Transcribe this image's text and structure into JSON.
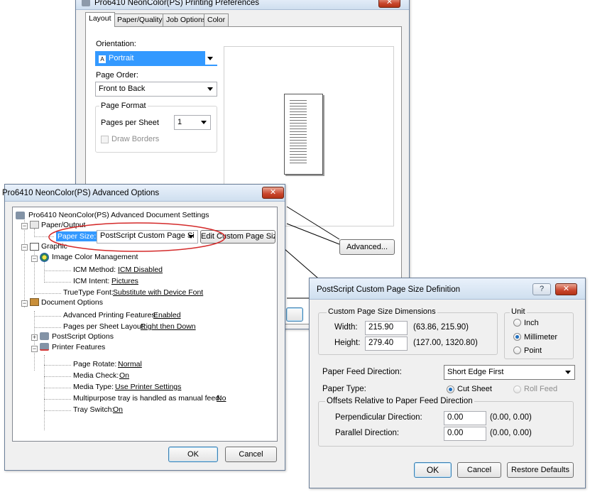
{
  "prefs": {
    "title": "Pro6410 NeonColor(PS) Printing Preferences",
    "tabs": [
      "Layout",
      "Paper/Quality",
      "Job Options",
      "Color"
    ],
    "orientation_label": "Orientation:",
    "orientation_value": "Portrait",
    "page_order_label": "Page Order:",
    "page_order_value": "Front to Back",
    "page_format_title": "Page Format",
    "pages_per_sheet_label": "Pages per Sheet",
    "pages_per_sheet_value": "1",
    "draw_borders_label": "Draw Borders",
    "advanced_button": "Advanced..."
  },
  "advanced": {
    "title": "Pro6410 NeonColor(PS) Advanced Options",
    "tree": {
      "root": "Pro6410 NeonColor(PS) Advanced Document Settings",
      "paper_output": "Paper/Output",
      "paper_size_label": "Paper Size:",
      "paper_size_value": "PostScript Custom Page Si",
      "edit_custom_button": "Edit Custom Page Size...",
      "graphic": "Graphic",
      "icm": "Image Color Management",
      "icm_method_label": "ICM Method:",
      "icm_method_value": "ICM Disabled",
      "icm_intent_label": "ICM Intent:",
      "icm_intent_value": "Pictures",
      "truetype_label": "TrueType Font:",
      "truetype_value": "Substitute with Device Font",
      "doc_options": "Document Options",
      "adv_printing_label": "Advanced Printing Features:",
      "adv_printing_value": "Enabled",
      "pages_layout_label": "Pages per Sheet Layout:",
      "pages_layout_value": "Right then Down",
      "ps_options": "PostScript Options",
      "printer_features": "Printer Features",
      "page_rotate_label": "Page Rotate:",
      "page_rotate_value": "Normal",
      "media_check_label": "Media Check:",
      "media_check_value": "On",
      "media_type_label": "Media Type:",
      "media_type_value": "Use Printer Settings",
      "multipurpose_label": "Multipurpose tray is handled as manual feed:",
      "multipurpose_value": "No",
      "tray_switch_label": "Tray Switch:",
      "tray_switch_value": "On"
    },
    "ok": "OK",
    "cancel": "Cancel"
  },
  "custom": {
    "title": "PostScript Custom Page Size Definition",
    "help": "?",
    "dims_title": "Custom Page Size Dimensions",
    "width_label": "Width:",
    "width_value": "215.90",
    "width_range": "(63.86, 215.90)",
    "height_label": "Height:",
    "height_value": "279.40",
    "height_range": "(127.00, 1320.80)",
    "unit_title": "Unit",
    "unit_inch": "Inch",
    "unit_mm": "Millimeter",
    "unit_point": "Point",
    "feed_dir_label": "Paper Feed Direction:",
    "feed_dir_value": "Short Edge First",
    "paper_type_label": "Paper Type:",
    "cut_sheet": "Cut Sheet",
    "roll_feed": "Roll Feed",
    "offsets_title": "Offsets Relative to Paper Feed Direction",
    "perp_label": "Perpendicular Direction:",
    "perp_value": "0.00",
    "perp_range": "(0.00, 0.00)",
    "parallel_label": "Parallel Direction:",
    "parallel_value": "0.00",
    "parallel_range": "(0.00, 0.00)",
    "ok": "OK",
    "cancel": "Cancel",
    "restore": "Restore Defaults"
  },
  "colors": {
    "selection": "#3399ff",
    "highlight_ellipse": "#d42a2a",
    "close_button": "#c9462d"
  }
}
